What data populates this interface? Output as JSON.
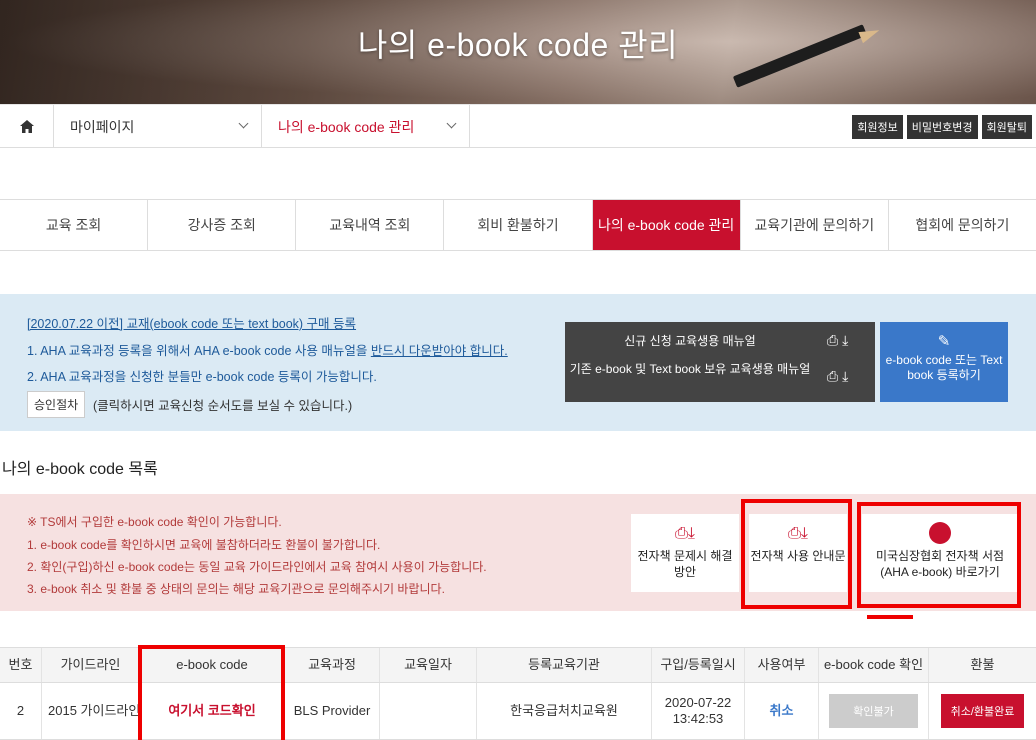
{
  "banner": {
    "title": "나의 e-book code 관리"
  },
  "breadcrumb": {
    "items": [
      "마이페이지",
      "나의 e-book code 관리"
    ],
    "buttons": [
      "회원정보",
      "비밀번호변경",
      "회원탈퇴"
    ]
  },
  "tabs": [
    {
      "label": "교육 조회",
      "active": false
    },
    {
      "label": "강사증 조회",
      "active": false
    },
    {
      "label": "교육내역 조회",
      "active": false
    },
    {
      "label": "회비 환불하기",
      "active": false
    },
    {
      "label": "나의 e-book code 관리",
      "active": true
    },
    {
      "label": "교육기관에 문의하기",
      "active": false
    },
    {
      "label": "협회에 문의하기",
      "active": false
    }
  ],
  "notice": {
    "line1": "[2020.07.22 이전] 교재(ebook code 또는 text book) 구매 등록",
    "line2_pre": "1. AHA 교육과정 등록을 위해서 AHA e-book code 사용 매뉴얼을 ",
    "line2_em": "반드시 다운받아야 합니다.",
    "line3": "2. AHA 교육과정을 신청한 분들만 e-book code 등록이 가능합니다.",
    "approval_button": "승인절차",
    "approval_note": "(클릭하시면 교육신청 순서도를 보실 수 있습니다.)",
    "manual_new": "신규 신청 교육생용 매뉴얼",
    "manual_existing": "기존 e-book 및 Text book 보유 교육생용 매뉴얼",
    "register_button": "e-book code 또는 Text book 등록하기"
  },
  "list_title": "나의 e-book code 목록",
  "pink_notice": {
    "lines": [
      "※ TS에서 구입한 e-book code 확인이 가능합니다.",
      "1. e-book code를 확인하시면 교육에 불참하더라도 환불이 불가합니다.",
      "2. 확인(구입)하신 e-book code는 동일 교육 가이드라인에서 교육 참여시 사용이 가능합니다.",
      "3. e-book 취소 및 환불 중 상태의 문의는 해당 교육기관으로 문의해주시기 바랍니다."
    ],
    "card1": "전자책 문제시 해결 방안",
    "card2": "전자책 사용 안내문",
    "card3": "미국심장협회 전자책 서점 (AHA e-book) 바로가기"
  },
  "table": {
    "headers": [
      "번호",
      "가이드라인",
      "e-book code",
      "교육과정",
      "교육일자",
      "등록교육기관",
      "구입/등록일시",
      "사용여부",
      "e-book code 확인",
      "환불"
    ],
    "row": {
      "no": "2",
      "guideline": "2015 가이드라인",
      "code": "여기서 코드확인",
      "course": "BLS Provider",
      "date": "",
      "institution": "한국응급처치교육원",
      "reg_date": "2020-07-22",
      "reg_time": "13:42:53",
      "usage": "취소",
      "check_button": "확인불가",
      "refund_button": "취소/환불완료"
    }
  },
  "colors": {
    "accent": "#c8102e",
    "blue": "#3a78c9",
    "highlight": "#ee0000"
  }
}
